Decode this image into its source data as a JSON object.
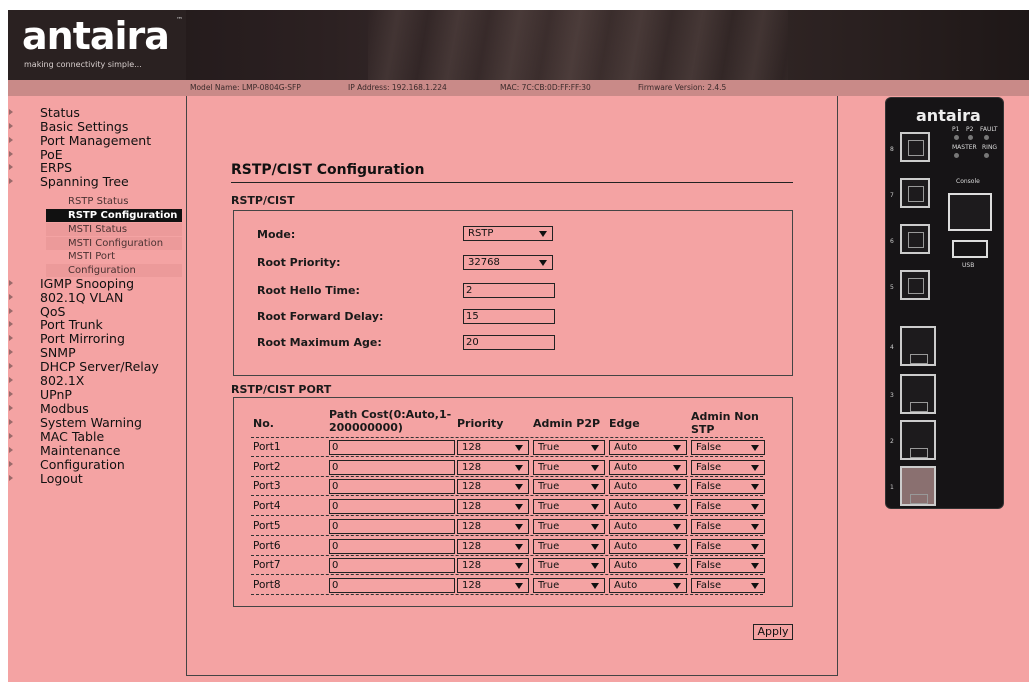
{
  "header": {
    "logo": "antaira",
    "logo_tm": "™",
    "tagline": "making connectivity simple...",
    "model": "Model Name: LMP-0804G-SFP",
    "ip": "IP Address: 192.168.1.224",
    "mac": "MAC: 7C:CB:0D:FF:FF:30",
    "firmware": "Firmware Version: 2.4.5"
  },
  "sidebar": {
    "items": [
      {
        "label": "Status"
      },
      {
        "label": "Basic Settings"
      },
      {
        "label": "Port Management"
      },
      {
        "label": "PoE"
      },
      {
        "label": "ERPS"
      },
      {
        "label": "Spanning Tree"
      },
      {
        "label": "IGMP Snooping"
      },
      {
        "label": "802.1Q VLAN"
      },
      {
        "label": "QoS"
      },
      {
        "label": "Port Trunk"
      },
      {
        "label": "Port Mirroring"
      },
      {
        "label": "SNMP"
      },
      {
        "label": "DHCP Server/Relay"
      },
      {
        "label": "802.1X"
      },
      {
        "label": "UPnP"
      },
      {
        "label": "Modbus"
      },
      {
        "label": "System Warning"
      },
      {
        "label": "MAC Table"
      },
      {
        "label": "Maintenance"
      },
      {
        "label": "Configuration"
      },
      {
        "label": "Logout"
      }
    ],
    "subitems": [
      {
        "label": "RSTP Status"
      },
      {
        "label": "RSTP Configuration"
      },
      {
        "label": "MSTI Status"
      },
      {
        "label": "MSTI Configuration"
      },
      {
        "label": "MSTI Port"
      },
      {
        "label": "Configuration"
      }
    ]
  },
  "main": {
    "title": "RSTP/CIST Configuration",
    "cist_section": "RSTP/CIST",
    "fields": {
      "mode_label": "Mode:",
      "mode_value": "RSTP",
      "priority_label": "Root Priority:",
      "priority_value": "32768",
      "hello_label": "Root Hello Time:",
      "hello_value": "2",
      "forward_label": "Root Forward Delay:",
      "forward_value": "15",
      "maxage_label": "Root Maximum Age:",
      "maxage_value": "20"
    },
    "port_section": "RSTP/CIST PORT",
    "columns": {
      "no": "No.",
      "path_cost_1": "Path Cost(0:Auto,1-",
      "path_cost_2": "200000000)",
      "priority": "Priority",
      "admin_p2p": "Admin P2P",
      "edge": "Edge",
      "admin_non_1": "Admin Non",
      "admin_non_2": "STP"
    },
    "ports": [
      {
        "name": "Port1",
        "path_cost": "0",
        "priority": "128",
        "p2p": "True",
        "edge": "Auto",
        "non_stp": "False"
      },
      {
        "name": "Port2",
        "path_cost": "0",
        "priority": "128",
        "p2p": "True",
        "edge": "Auto",
        "non_stp": "False"
      },
      {
        "name": "Port3",
        "path_cost": "0",
        "priority": "128",
        "p2p": "True",
        "edge": "Auto",
        "non_stp": "False"
      },
      {
        "name": "Port4",
        "path_cost": "0",
        "priority": "128",
        "p2p": "True",
        "edge": "Auto",
        "non_stp": "False"
      },
      {
        "name": "Port5",
        "path_cost": "0",
        "priority": "128",
        "p2p": "True",
        "edge": "Auto",
        "non_stp": "False"
      },
      {
        "name": "Port6",
        "path_cost": "0",
        "priority": "128",
        "p2p": "True",
        "edge": "Auto",
        "non_stp": "False"
      },
      {
        "name": "Port7",
        "path_cost": "0",
        "priority": "128",
        "p2p": "True",
        "edge": "Auto",
        "non_stp": "False"
      },
      {
        "name": "Port8",
        "path_cost": "0",
        "priority": "128",
        "p2p": "True",
        "edge": "Auto",
        "non_stp": "False"
      }
    ],
    "apply_label": "Apply"
  },
  "device": {
    "logo": "antaira",
    "p1": "P1",
    "p2": "P2",
    "fault": "FAULT",
    "master": "MASTER",
    "ring": "RING",
    "console": "Console",
    "usb": "USB",
    "port_numbers": [
      "8",
      "7",
      "6",
      "5",
      "4",
      "3",
      "2",
      "1"
    ]
  },
  "colors": {
    "background": "#f4a3a3",
    "header_dark": "#2a2121",
    "active_nav": "#111111"
  }
}
